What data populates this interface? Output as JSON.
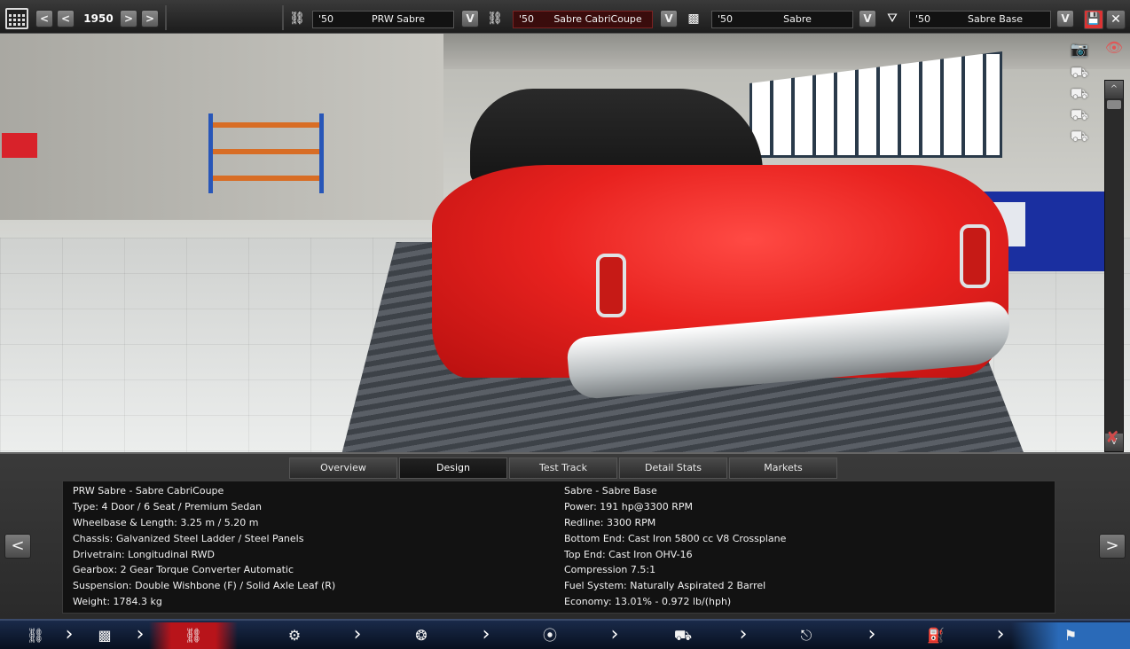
{
  "topbar": {
    "year": "1950",
    "prev_label": "<",
    "prev2_label": "<",
    "next_label": ">",
    "next2_label": ">",
    "dropdown_label": "V",
    "selectors": [
      {
        "icon": "car-model-icon",
        "year": "'50",
        "name": "PRW Sabre"
      },
      {
        "icon": "car-trim-icon",
        "year": "'50",
        "name": "Sabre CabriCoupe"
      },
      {
        "icon": "engine-family-icon",
        "year": "'50",
        "name": "Sabre"
      },
      {
        "icon": "engine-variant-icon",
        "year": "'50",
        "name": "Sabre Base"
      }
    ]
  },
  "tabs": [
    "Overview",
    "Design",
    "Test Track",
    "Detail Stats",
    "Markets"
  ],
  "active_tab": "Design",
  "car_info": [
    "PRW Sabre - Sabre CabriCoupe",
    "Type: 4 Door / 6 Seat / Premium Sedan",
    "Wheelbase & Length: 3.25 m / 5.20 m",
    "Chassis: Galvanized Steel Ladder / Steel Panels",
    "Drivetrain: Longitudinal RWD",
    "Gearbox: 2 Gear Torque Converter Automatic",
    "Suspension: Double Wishbone (F) / Solid Axle Leaf (R)",
    "Weight: 1784.3 kg"
  ],
  "engine_info": [
    "Sabre - Sabre Base",
    "Power: 191 hp@3300 RPM",
    "Redline: 3300 RPM",
    "Bottom End: Cast Iron 5800 cc V8 Crossplane",
    "Top End: Cast Iron OHV-16",
    "Compression 7.5:1",
    "Fuel System: Naturally Aspirated 2 Barrel",
    "Economy: 13.01% - 0.972 lb/(hph)"
  ],
  "panel": {
    "left_arrow": "<",
    "right_arrow": ">"
  },
  "scrollbar": {
    "up": "^",
    "down": "V"
  },
  "colors": {
    "accent_red": "#e8221f",
    "active_nav": "#b8141a",
    "nav_bg": "#07101f",
    "panel_bg": "#2a2a2a"
  }
}
